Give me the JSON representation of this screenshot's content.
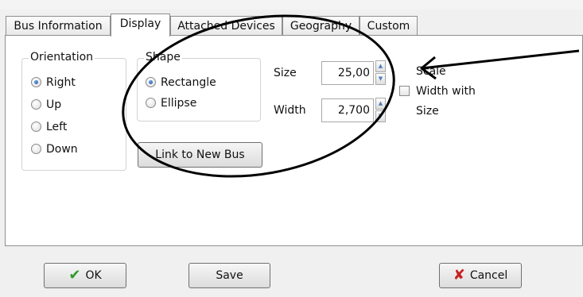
{
  "tabs": [
    {
      "label": "Bus Information",
      "active": false
    },
    {
      "label": "Display",
      "active": true
    },
    {
      "label": "Attached Devices",
      "active": false
    },
    {
      "label": "Geography",
      "active": false
    },
    {
      "label": "Custom",
      "active": false
    }
  ],
  "orientation": {
    "legend": "Orientation",
    "options": [
      "Right",
      "Up",
      "Left",
      "Down"
    ],
    "selected": "Right"
  },
  "shape": {
    "legend": "Shape",
    "options": [
      "Rectangle",
      "Ellipse"
    ],
    "selected": "Rectangle"
  },
  "size": {
    "label": "Size",
    "value": "25,00"
  },
  "width": {
    "label": "Width",
    "value": "2,700"
  },
  "scale_checkbox": {
    "lines": [
      "Scale",
      "Width with",
      "Size"
    ],
    "checked": false
  },
  "link_button": {
    "label": "Link to New Bus"
  },
  "footer": {
    "ok_label": "OK",
    "save_label": "Save",
    "cancel_label": "Cancel"
  },
  "icons": {
    "ok": "checkmark-icon",
    "cancel": "x-icon"
  },
  "colors": {
    "ok_icon": "#2e9a28",
    "cancel_icon": "#c82020",
    "radio_selected": "#1a4fa0"
  }
}
